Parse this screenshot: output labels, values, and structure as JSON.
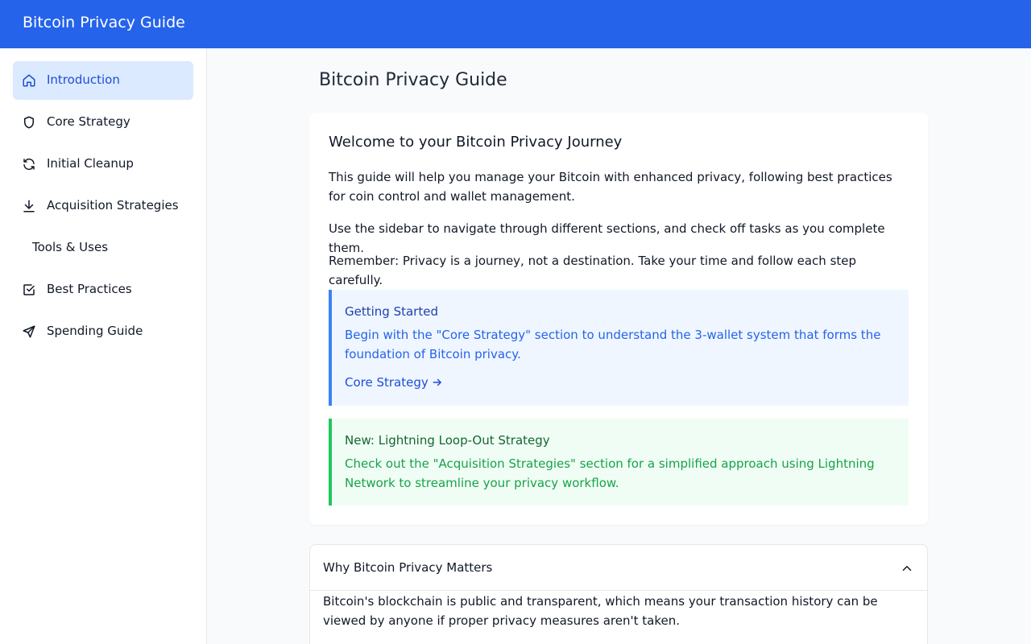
{
  "header": {
    "title": "Bitcoin Privacy Guide"
  },
  "sidebar": {
    "items": [
      {
        "label": "Introduction",
        "icon": "home-icon",
        "active": true
      },
      {
        "label": "Core Strategy",
        "icon": "shield-icon"
      },
      {
        "label": "Initial Cleanup",
        "icon": "refresh-icon"
      },
      {
        "label": "Acquisition Strategies",
        "icon": "download-icon"
      },
      {
        "label": "Tools & Uses",
        "icon": ""
      },
      {
        "label": "Best Practices",
        "icon": "check-square-icon"
      },
      {
        "label": "Spending Guide",
        "icon": "send-icon"
      }
    ]
  },
  "main": {
    "page_title": "Bitcoin Privacy Guide",
    "welcome": {
      "heading": "Welcome to your Bitcoin Privacy Journey",
      "paragraphs": [
        "This guide will help you manage your Bitcoin with enhanced privacy, following best practices for coin control and wallet management.",
        "Use the sidebar to navigate through different sections, and check off tasks as you complete them.",
        "Remember: Privacy is a journey, not a destination. Take your time and follow each step carefully."
      ],
      "getting_started": {
        "title": "Getting Started",
        "text": "Begin with the \"Core Strategy\" section to understand the 3-wallet system that forms the foundation of Bitcoin privacy.",
        "link": "Core Strategy"
      },
      "new_strategy": {
        "title": "New: Lightning Loop-Out Strategy",
        "text": "Check out the \"Acquisition Strategies\" section for a simplified approach using Lightning Network to streamline your privacy workflow."
      }
    },
    "accordion": {
      "title": "Why Bitcoin Privacy Matters",
      "body": "Bitcoin's blockchain is public and transparent, which means your transaction history can be viewed by anyone if proper privacy measures aren't taken."
    }
  },
  "colors": {
    "brand": "#2563eb",
    "active_bg": "#dbeafe",
    "info": "#3b82f6",
    "success": "#22c55e"
  }
}
